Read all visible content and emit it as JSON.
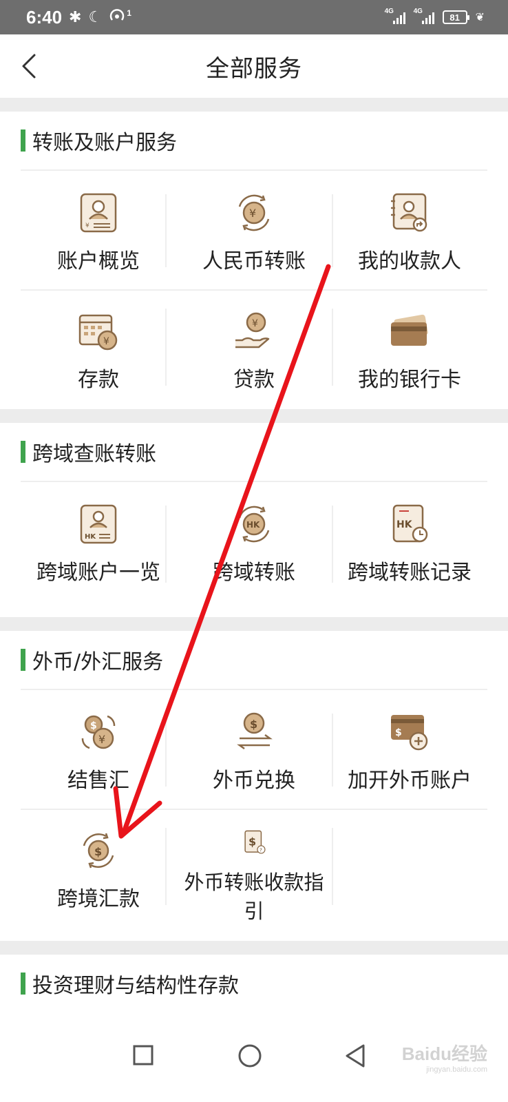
{
  "status_bar": {
    "time": "6:40",
    "signal_1_label": "4G",
    "signal_2_label": "4G",
    "battery": "81",
    "hotspot_sup": "1"
  },
  "header": {
    "title": "全部服务"
  },
  "sections": [
    {
      "title": "转账及账户服务",
      "items": [
        {
          "label": "账户概览",
          "icon": "account-overview-icon"
        },
        {
          "label": "人民币转账",
          "icon": "rmb-transfer-icon"
        },
        {
          "label": "我的收款人",
          "icon": "payee-icon"
        },
        {
          "label": "存款",
          "icon": "deposit-icon"
        },
        {
          "label": "贷款",
          "icon": "loan-icon"
        },
        {
          "label": "我的银行卡",
          "icon": "bank-card-icon"
        }
      ]
    },
    {
      "title": "跨域查账转账",
      "items": [
        {
          "label": "跨域账户一览",
          "icon": "hk-account-icon"
        },
        {
          "label": "跨域转账",
          "icon": "hk-transfer-icon"
        },
        {
          "label": "跨域转账记录",
          "icon": "hk-record-icon"
        }
      ]
    },
    {
      "title": "外币/外汇服务",
      "items": [
        {
          "label": "结售汇",
          "icon": "fx-settlement-icon"
        },
        {
          "label": "外币兑换",
          "icon": "currency-exchange-icon"
        },
        {
          "label": "加开外币账户",
          "icon": "add-fx-account-icon"
        },
        {
          "label": "跨境汇款",
          "icon": "cross-border-remit-icon"
        },
        {
          "label": "外币转账收款指引",
          "icon": "fx-guide-icon"
        }
      ]
    },
    {
      "title": "投资理财与结构性存款",
      "items": []
    }
  ],
  "watermark": {
    "text": "Baidu经验",
    "sub": "jingyan.baidu.com"
  },
  "colors": {
    "accent_green": "#3fa34d",
    "icon_tan": "#c9a57a",
    "icon_brown": "#8a6a48",
    "annotation_red": "#e8141b"
  }
}
